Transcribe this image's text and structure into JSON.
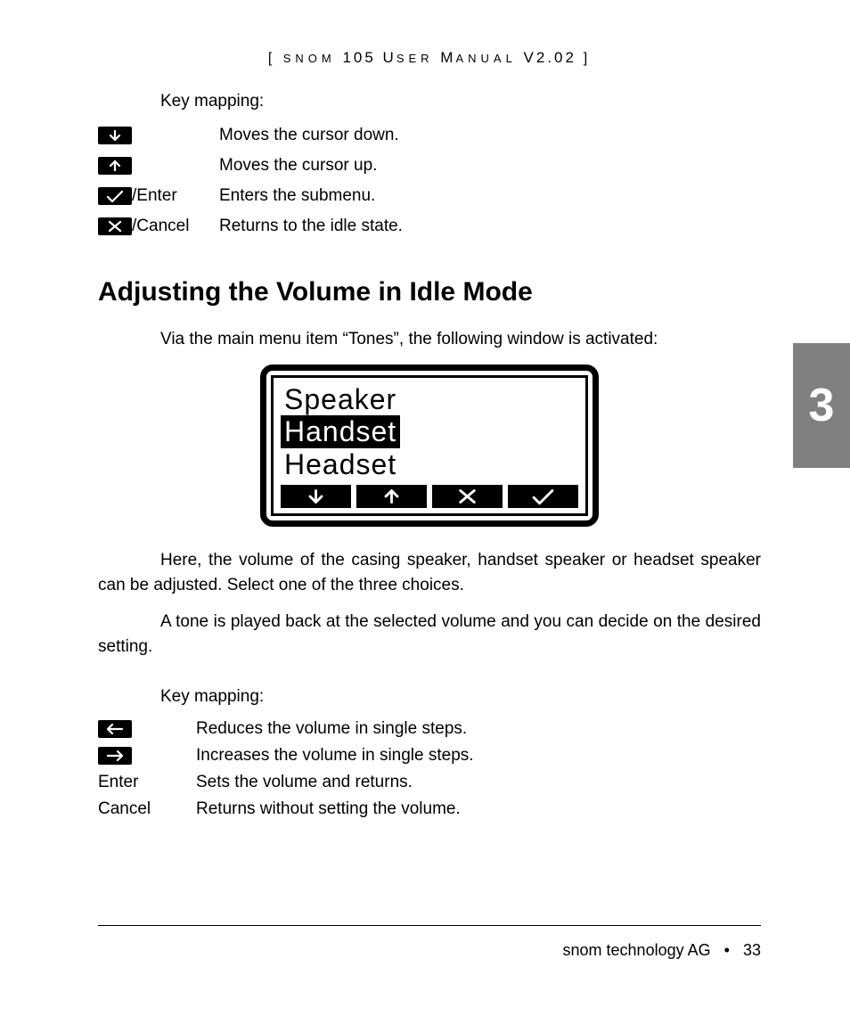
{
  "header": {
    "prefix_small": "SNOM",
    "num": " 105 ",
    "u": "U",
    "ser": "SER",
    "m": " M",
    "anual": "ANUAL",
    "ver": " V2.02 "
  },
  "keymap1": {
    "label": "Key mapping:",
    "rows": [
      {
        "icon": "down",
        "suffix": "",
        "desc": "Moves the cursor down."
      },
      {
        "icon": "up",
        "suffix": "",
        "desc": "Moves the cursor up."
      },
      {
        "icon": "check",
        "suffix": "/Enter",
        "desc": "Enters the submenu."
      },
      {
        "icon": "cross",
        "suffix": "/Cancel",
        "desc": "Returns to the idle state."
      }
    ]
  },
  "section_title": "Adjusting the Volume in Idle Mode",
  "para1": "Via the main menu item “Tones”, the following window is activated:",
  "lcd": {
    "line1": "Speaker",
    "line2": "Handset",
    "line3": "Headset",
    "soft": [
      "down",
      "up",
      "cross",
      "check"
    ]
  },
  "para2": "Here, the volume of the casing speaker, handset speaker or headset speaker can be adjusted. Select one of the three choices.",
  "para3": "A tone is played back at the selected volume and you can decide on the desired setting.",
  "keymap2": {
    "label": "Key mapping:",
    "rows": [
      {
        "icon": "left",
        "text": "",
        "desc": "Reduces the volume in single steps."
      },
      {
        "icon": "right",
        "text": "",
        "desc": "Increases the volume in single steps."
      },
      {
        "icon": "",
        "text": "Enter",
        "desc": "Sets the volume and returns."
      },
      {
        "icon": "",
        "text": "Cancel",
        "desc": "Returns without setting the volume."
      }
    ]
  },
  "chapter": "3",
  "footer": {
    "company": "snom technology AG",
    "bullet": "•",
    "page": "33"
  }
}
